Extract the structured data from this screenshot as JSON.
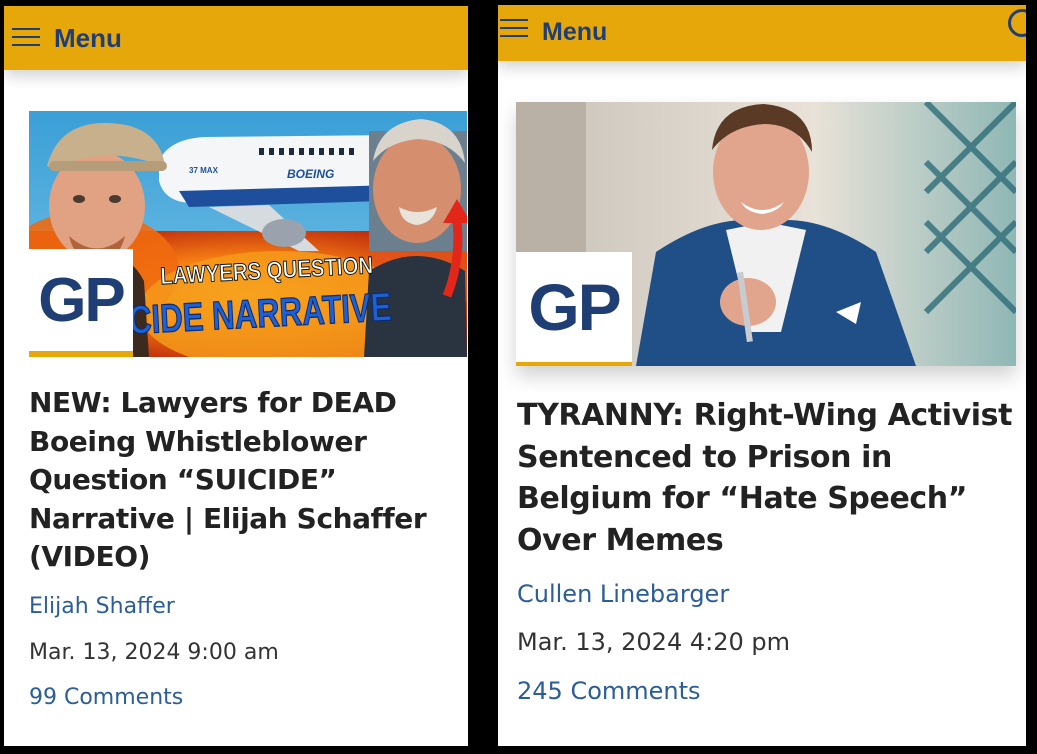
{
  "colors": {
    "menu_bar": "#e6a70b",
    "menu_text": "#1f3f74",
    "link_blue": "#2a5d99",
    "headline": "#222222"
  },
  "left_panel": {
    "menu": {
      "label": "Menu",
      "icon": "hamburger-icon"
    },
    "thumbnail": {
      "logo_text": "GP",
      "overlay_line1": "LAWYERS QUESTION",
      "overlay_line2": "ICIDE NARRATIVE",
      "plane_text": "BOEING",
      "plane_model": "37 MAX"
    },
    "article": {
      "headline": "NEW: Lawyers for DEAD Boeing Whistleblower Question “SUICIDE” Narrative | Elijah Schaffer (VIDEO)",
      "author": "Elijah Shaffer",
      "date": "Mar. 13, 2024 9:00 am",
      "comments": "99 Comments"
    }
  },
  "right_panel": {
    "menu": {
      "label": "Menu",
      "icon": "hamburger-icon",
      "search_icon": "search-icon"
    },
    "thumbnail": {
      "logo_text": "GP"
    },
    "article": {
      "headline": "TYRANNY: Right-Wing Activist Sentenced to Prison in Belgium for “Hate Speech” Over Memes",
      "author": "Cullen Linebarger",
      "date": "Mar. 13, 2024 4:20 pm",
      "comments": "245 Comments"
    }
  }
}
